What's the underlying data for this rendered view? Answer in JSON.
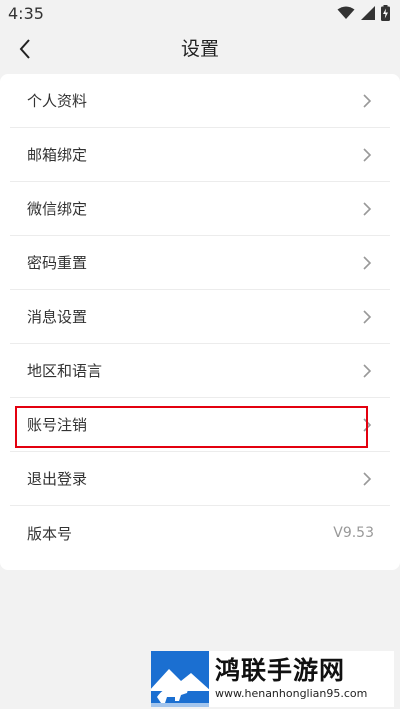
{
  "status_bar": {
    "time": "4:35"
  },
  "header": {
    "title": "设置"
  },
  "settings": {
    "items": [
      {
        "label": "个人资料",
        "value": ""
      },
      {
        "label": "邮箱绑定",
        "value": ""
      },
      {
        "label": "微信绑定",
        "value": ""
      },
      {
        "label": "密码重置",
        "value": ""
      },
      {
        "label": "消息设置",
        "value": ""
      },
      {
        "label": "地区和语言",
        "value": ""
      },
      {
        "label": "账号注销",
        "value": ""
      },
      {
        "label": "退出登录",
        "value": ""
      },
      {
        "label": "版本号",
        "value": "V9.53"
      }
    ]
  },
  "colors": {
    "highlight": "#e3000f",
    "background": "#f2f2f2",
    "card": "#ffffff",
    "logo_blue": "#1b6fd1"
  },
  "watermark": {
    "title": "鸿联手游网",
    "url": "www.henanhonglian95.com"
  }
}
